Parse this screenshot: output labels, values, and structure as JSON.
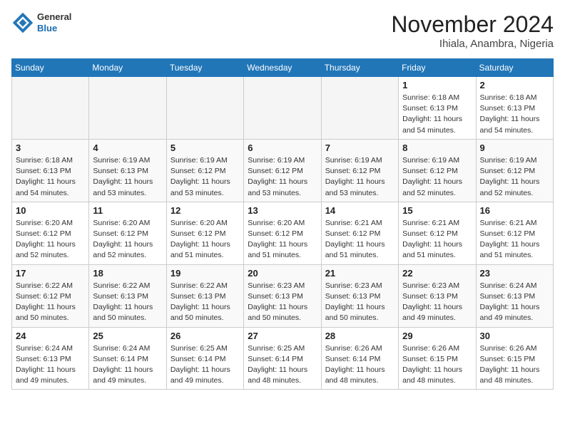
{
  "header": {
    "logo": {
      "general": "General",
      "blue": "Blue"
    },
    "title": "November 2024",
    "location": "Ihiala, Anambra, Nigeria"
  },
  "weekdays": [
    "Sunday",
    "Monday",
    "Tuesday",
    "Wednesday",
    "Thursday",
    "Friday",
    "Saturday"
  ],
  "weeks": [
    [
      {
        "day": "",
        "info": ""
      },
      {
        "day": "",
        "info": ""
      },
      {
        "day": "",
        "info": ""
      },
      {
        "day": "",
        "info": ""
      },
      {
        "day": "",
        "info": ""
      },
      {
        "day": "1",
        "info": "Sunrise: 6:18 AM\nSunset: 6:13 PM\nDaylight: 11 hours\nand 54 minutes."
      },
      {
        "day": "2",
        "info": "Sunrise: 6:18 AM\nSunset: 6:13 PM\nDaylight: 11 hours\nand 54 minutes."
      }
    ],
    [
      {
        "day": "3",
        "info": "Sunrise: 6:18 AM\nSunset: 6:13 PM\nDaylight: 11 hours\nand 54 minutes."
      },
      {
        "day": "4",
        "info": "Sunrise: 6:19 AM\nSunset: 6:13 PM\nDaylight: 11 hours\nand 53 minutes."
      },
      {
        "day": "5",
        "info": "Sunrise: 6:19 AM\nSunset: 6:12 PM\nDaylight: 11 hours\nand 53 minutes."
      },
      {
        "day": "6",
        "info": "Sunrise: 6:19 AM\nSunset: 6:12 PM\nDaylight: 11 hours\nand 53 minutes."
      },
      {
        "day": "7",
        "info": "Sunrise: 6:19 AM\nSunset: 6:12 PM\nDaylight: 11 hours\nand 53 minutes."
      },
      {
        "day": "8",
        "info": "Sunrise: 6:19 AM\nSunset: 6:12 PM\nDaylight: 11 hours\nand 52 minutes."
      },
      {
        "day": "9",
        "info": "Sunrise: 6:19 AM\nSunset: 6:12 PM\nDaylight: 11 hours\nand 52 minutes."
      }
    ],
    [
      {
        "day": "10",
        "info": "Sunrise: 6:20 AM\nSunset: 6:12 PM\nDaylight: 11 hours\nand 52 minutes."
      },
      {
        "day": "11",
        "info": "Sunrise: 6:20 AM\nSunset: 6:12 PM\nDaylight: 11 hours\nand 52 minutes."
      },
      {
        "day": "12",
        "info": "Sunrise: 6:20 AM\nSunset: 6:12 PM\nDaylight: 11 hours\nand 51 minutes."
      },
      {
        "day": "13",
        "info": "Sunrise: 6:20 AM\nSunset: 6:12 PM\nDaylight: 11 hours\nand 51 minutes."
      },
      {
        "day": "14",
        "info": "Sunrise: 6:21 AM\nSunset: 6:12 PM\nDaylight: 11 hours\nand 51 minutes."
      },
      {
        "day": "15",
        "info": "Sunrise: 6:21 AM\nSunset: 6:12 PM\nDaylight: 11 hours\nand 51 minutes."
      },
      {
        "day": "16",
        "info": "Sunrise: 6:21 AM\nSunset: 6:12 PM\nDaylight: 11 hours\nand 51 minutes."
      }
    ],
    [
      {
        "day": "17",
        "info": "Sunrise: 6:22 AM\nSunset: 6:12 PM\nDaylight: 11 hours\nand 50 minutes."
      },
      {
        "day": "18",
        "info": "Sunrise: 6:22 AM\nSunset: 6:13 PM\nDaylight: 11 hours\nand 50 minutes."
      },
      {
        "day": "19",
        "info": "Sunrise: 6:22 AM\nSunset: 6:13 PM\nDaylight: 11 hours\nand 50 minutes."
      },
      {
        "day": "20",
        "info": "Sunrise: 6:23 AM\nSunset: 6:13 PM\nDaylight: 11 hours\nand 50 minutes."
      },
      {
        "day": "21",
        "info": "Sunrise: 6:23 AM\nSunset: 6:13 PM\nDaylight: 11 hours\nand 50 minutes."
      },
      {
        "day": "22",
        "info": "Sunrise: 6:23 AM\nSunset: 6:13 PM\nDaylight: 11 hours\nand 49 minutes."
      },
      {
        "day": "23",
        "info": "Sunrise: 6:24 AM\nSunset: 6:13 PM\nDaylight: 11 hours\nand 49 minutes."
      }
    ],
    [
      {
        "day": "24",
        "info": "Sunrise: 6:24 AM\nSunset: 6:13 PM\nDaylight: 11 hours\nand 49 minutes."
      },
      {
        "day": "25",
        "info": "Sunrise: 6:24 AM\nSunset: 6:14 PM\nDaylight: 11 hours\nand 49 minutes."
      },
      {
        "day": "26",
        "info": "Sunrise: 6:25 AM\nSunset: 6:14 PM\nDaylight: 11 hours\nand 49 minutes."
      },
      {
        "day": "27",
        "info": "Sunrise: 6:25 AM\nSunset: 6:14 PM\nDaylight: 11 hours\nand 48 minutes."
      },
      {
        "day": "28",
        "info": "Sunrise: 6:26 AM\nSunset: 6:14 PM\nDaylight: 11 hours\nand 48 minutes."
      },
      {
        "day": "29",
        "info": "Sunrise: 6:26 AM\nSunset: 6:15 PM\nDaylight: 11 hours\nand 48 minutes."
      },
      {
        "day": "30",
        "info": "Sunrise: 6:26 AM\nSunset: 6:15 PM\nDaylight: 11 hours\nand 48 minutes."
      }
    ]
  ]
}
